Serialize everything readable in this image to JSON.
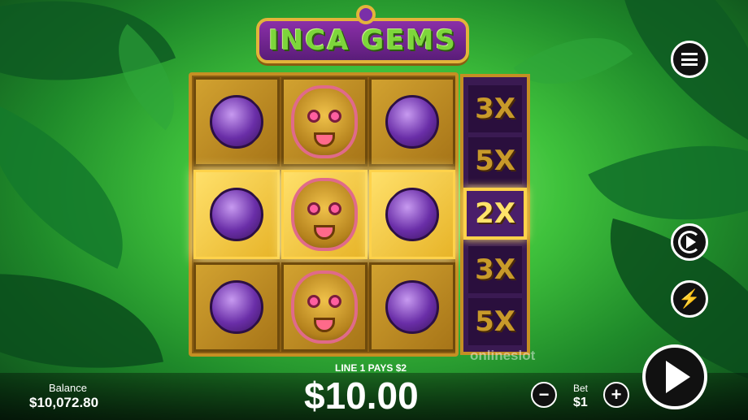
{
  "game": {
    "title": "INCA GEMS"
  },
  "reels": {
    "rows": [
      [
        "purple-gem",
        "sun-mask",
        "purple-gem"
      ],
      [
        "purple-gem",
        "sun-mask",
        "purple-gem"
      ],
      [
        "purple-gem",
        "sun-mask",
        "purple-gem"
      ]
    ],
    "winning_row": 2
  },
  "multipliers": {
    "items": [
      "3X",
      "5X",
      "2X",
      "3X",
      "5X"
    ],
    "active_index": 2
  },
  "status": {
    "win_message": "LINE 1 PAYS $2",
    "win_amount": "$10.00"
  },
  "balance": {
    "label": "Balance",
    "value": "$10,072.80"
  },
  "bet": {
    "label": "Bet",
    "value": "$1",
    "minus": "−",
    "plus": "+"
  },
  "watermark": "onlineslot",
  "icons": {
    "menu": "menu-icon",
    "autoplay": "autoplay-icon",
    "turbo": "turbo-icon",
    "spin": "play-icon"
  },
  "colors": {
    "frame": "#c58f23",
    "win_highlight": "#ffd24a",
    "multiplier_bg": "#3a1a52",
    "gem": "#6a2ea8"
  }
}
